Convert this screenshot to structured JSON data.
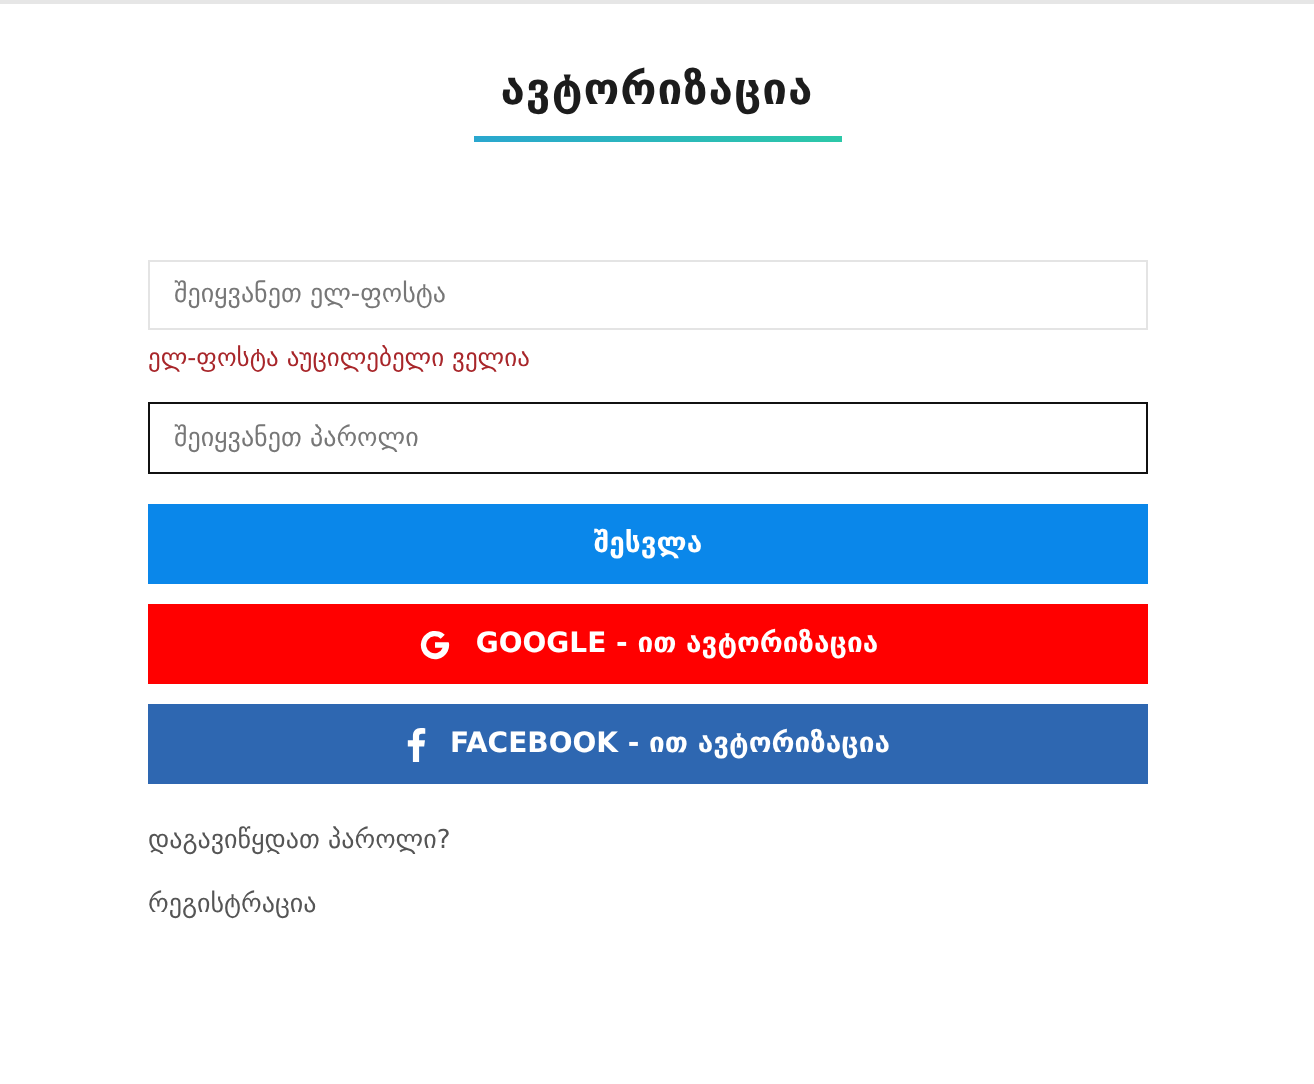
{
  "title": "ავტორიზაცია",
  "fields": [
    {
      "placeholder": "შეიყვანეთ ელ-ფოსტა",
      "focused": false,
      "error": "ელ-ფოსტა აუცილებელი ველია"
    },
    {
      "placeholder": "შეიყვანეთ პაროლი",
      "focused": true
    }
  ],
  "buttons": [
    {
      "kind": "primary",
      "label": "შესვლა"
    },
    {
      "kind": "google",
      "label": "GOOGLE - ით ავტორიზაცია"
    },
    {
      "kind": "facebook",
      "label": "FACEBOOK - ით ავტორიზაცია"
    }
  ],
  "links": [
    "დაგავიწყდათ პაროლი?",
    "რეგისტრაცია"
  ]
}
